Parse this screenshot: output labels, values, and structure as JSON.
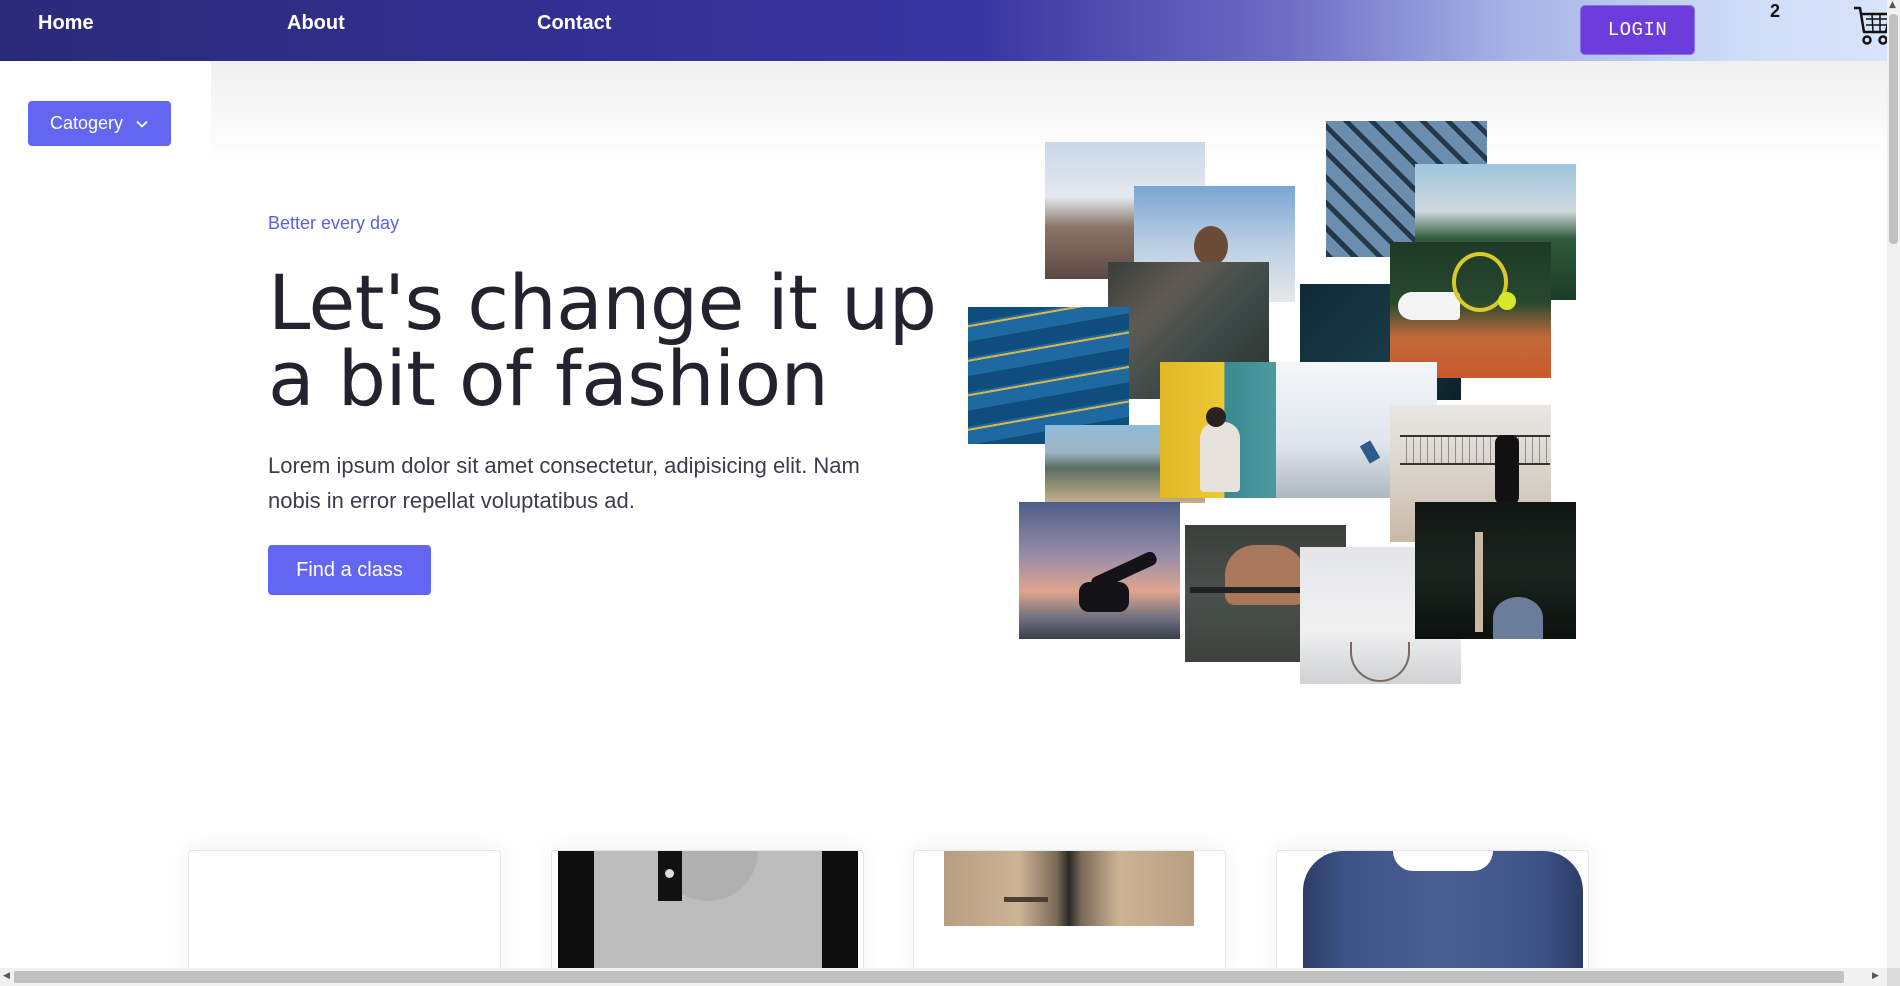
{
  "nav": {
    "links": [
      "Home",
      "About",
      "Contact"
    ],
    "login_label": "LOGIN",
    "cart_count": "2",
    "cart_icon": "shopping-cart-icon"
  },
  "sidebar": {
    "category_label": "Catogery",
    "category_icon": "chevron-down-icon"
  },
  "hero": {
    "eyebrow": "Better every day",
    "headline": "Let's change it up a bit of fashion",
    "lead": "Lorem ipsum dolor sit amet consectetur, adipisicing elit. Nam nobis in error repellat voluptatibus ad.",
    "cta_label": "Find a class"
  },
  "collage": {
    "photos": [
      "basketball-hoop",
      "man-portrait",
      "chain-link-fence",
      "tennis-court",
      "rock-climbing-detail",
      "dark-fabric",
      "swimming-pool",
      "climbing-wall",
      "snowboarder-sky",
      "beach-crowd",
      "volleyball-game",
      "yoga-sunset",
      "weightlifting",
      "basketball-net",
      "dark-photo"
    ]
  },
  "products": {
    "cards": [
      "blank",
      "raglan-shirt",
      "trench-coat",
      "blue-sweater"
    ]
  },
  "theme": {
    "accent": "#6366f1",
    "login_color": "#6c3cdc",
    "nav_start": "#2b2a78",
    "nav_end": "#d8e4fa"
  }
}
